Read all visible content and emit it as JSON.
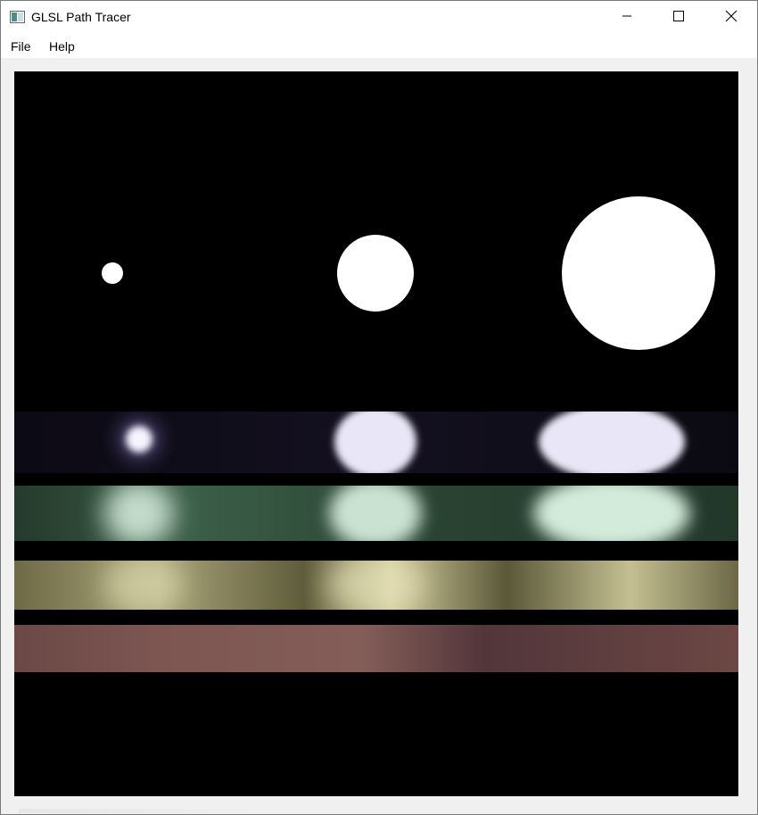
{
  "window": {
    "title": "GLSL Path Tracer",
    "controls": {
      "minimize": "minimize",
      "maximize": "maximize",
      "close": "close"
    }
  },
  "menubar": {
    "items": [
      {
        "label": "File"
      },
      {
        "label": "Help"
      }
    ]
  },
  "render": {
    "background_color": "#000000",
    "emitter_color": "#ffffff",
    "strip_colors": [
      "#e9e6f7",
      "#d3ebda",
      "#e6e3b8",
      "#7e5552"
    ],
    "emissive_sphere_count": 3,
    "material_strip_count": 4
  }
}
